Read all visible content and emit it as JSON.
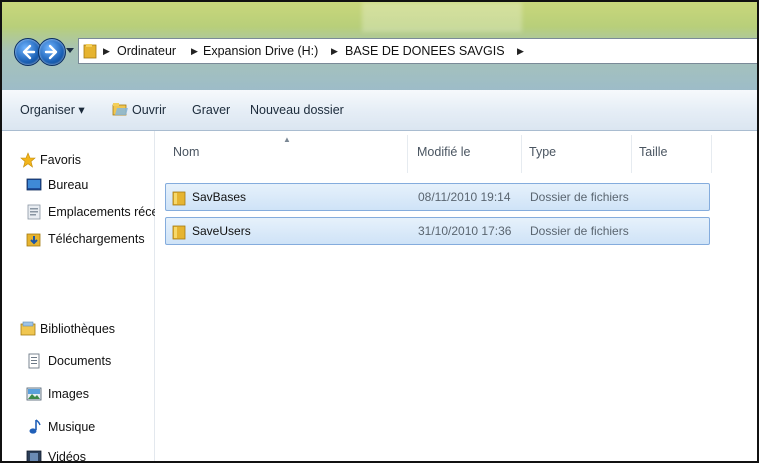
{
  "breadcrumb": {
    "segments": [
      "Ordinateur",
      "Expansion Drive (H:)",
      "BASE DE DONEES SAVGIS"
    ]
  },
  "toolbar": {
    "organize": "Organiser ▾",
    "open": "Ouvrir",
    "burn": "Graver",
    "new_folder": "Nouveau dossier"
  },
  "nav": {
    "favorites": "Favoris",
    "desktop": "Bureau",
    "recent": "Emplacements récer",
    "downloads": "Téléchargements",
    "libraries": "Bibliothèques",
    "documents": "Documents",
    "images": "Images",
    "music": "Musique",
    "videos": "Vidéos"
  },
  "columns": {
    "name": "Nom",
    "modified": "Modifié le",
    "type": "Type",
    "size": "Taille"
  },
  "files": [
    {
      "name": "SavBases",
      "modified": "08/11/2010 19:14",
      "type": "Dossier de fichiers",
      "size": ""
    },
    {
      "name": "SaveUsers",
      "modified": "31/10/2010 17:36",
      "type": "Dossier de fichiers",
      "size": ""
    }
  ],
  "colors": {
    "selection": "#cfe3f7",
    "selection_border": "#84acdd",
    "toolbar": "#e6eef6"
  }
}
